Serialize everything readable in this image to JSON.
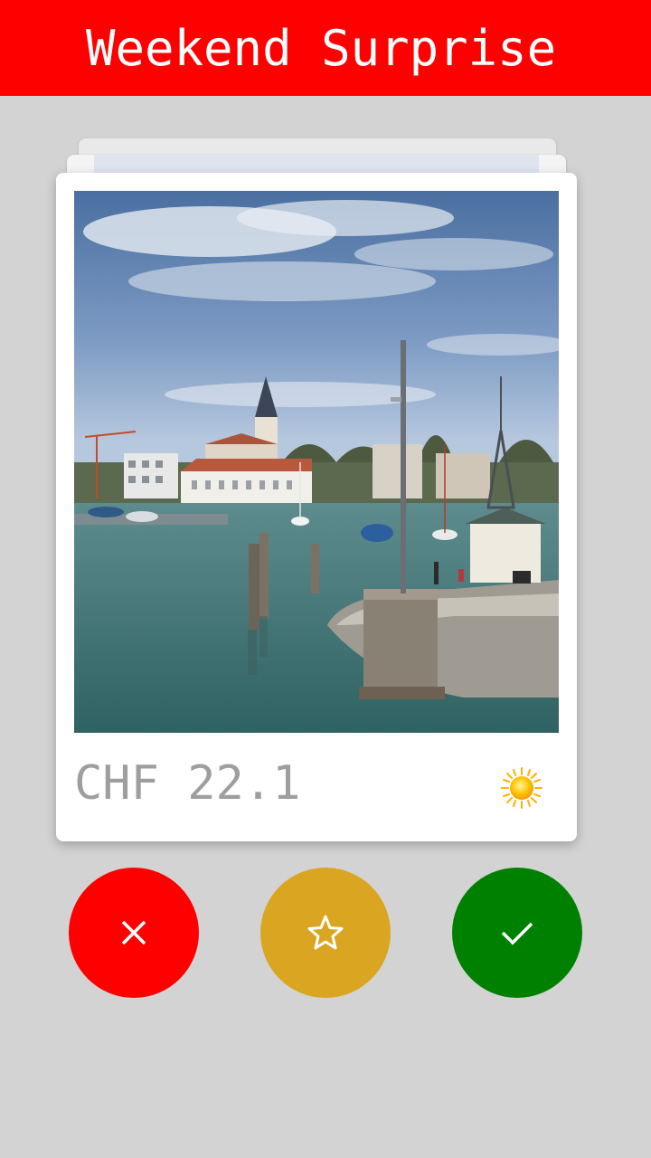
{
  "header": {
    "title": "Weekend Surprise",
    "color": "#ff0000"
  },
  "card": {
    "image_alt": "Harbour with lighthouse and church tower by a lake",
    "price_label": "CHF 22.1",
    "weather_icon": "sun-icon"
  },
  "actions": {
    "reject": {
      "icon": "close-icon",
      "color": "#ff0000"
    },
    "favorite": {
      "icon": "star-icon",
      "color": "#daa520"
    },
    "accept": {
      "icon": "check-icon",
      "color": "#008000"
    }
  },
  "colors": {
    "background": "#d3d3d3"
  }
}
